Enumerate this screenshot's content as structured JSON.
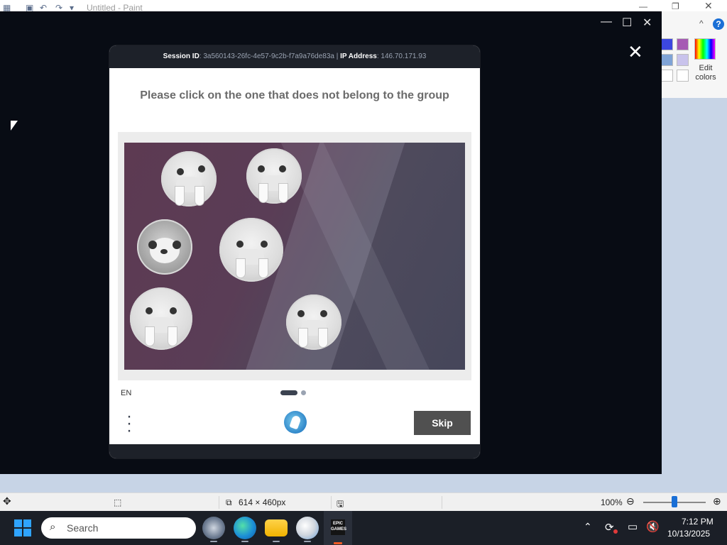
{
  "paint": {
    "title": "Untitled - Paint",
    "edit_colors_label": "Edit colors",
    "help_glyph": "?",
    "window_controls": {
      "minimize": "—",
      "restore": "❐",
      "close": "✕"
    },
    "colors": [
      "#3c47e0",
      "#a65ab4",
      "#7fa3d6",
      "#c9c3ec"
    ]
  },
  "status_bar": {
    "canvas_size": "614 × 460px",
    "zoom": "100%"
  },
  "overlay": {
    "controls": {
      "minimize": "—",
      "maximize": "☐",
      "close": "✕"
    }
  },
  "captcha": {
    "session_label": "Session ID",
    "session_id": "3a560143-26fc-4e57-9c2b-f7a9a76de83a",
    "ip_label": "IP Address",
    "ip_address": "146.70.171.93",
    "close_glyph": "✕",
    "prompt": "Please click on the one that does not belong to the group",
    "language": "EN",
    "skip_label": "Skip",
    "tiles": [
      {
        "kind": "walrus"
      },
      {
        "kind": "walrus"
      },
      {
        "kind": "seal"
      },
      {
        "kind": "walrus"
      },
      {
        "kind": "walrus"
      },
      {
        "kind": "walrus"
      }
    ],
    "pagination": {
      "current": 1,
      "total": 2
    }
  },
  "taskbar": {
    "search_placeholder": "Search",
    "apps": [
      "settings-icon",
      "edge-browser-icon",
      "file-explorer-icon",
      "paint-app-icon",
      "epic-games-icon"
    ],
    "epic_label": "EPIC GAMES",
    "clock": {
      "time": "7:12 PM",
      "date": "10/13/2025"
    }
  }
}
